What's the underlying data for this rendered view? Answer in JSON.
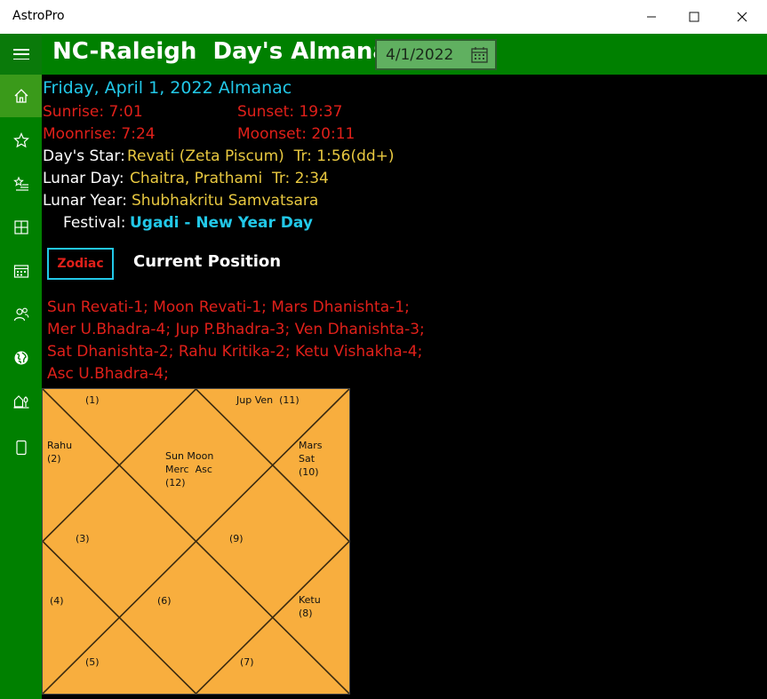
{
  "window": {
    "title": "AstroPro",
    "min_label": "—",
    "max_label": "☐",
    "close_label": "✕"
  },
  "header": {
    "title": "NC-Raleigh  Day's Almanac",
    "date": "4/1/2022"
  },
  "sidebar": {
    "items": [
      {
        "icon": "home-icon",
        "active": true
      },
      {
        "icon": "star-icon"
      },
      {
        "icon": "starred-list-icon"
      },
      {
        "icon": "grid-icon"
      },
      {
        "icon": "calendar-icon"
      },
      {
        "icon": "people-icon"
      },
      {
        "icon": "globe-icon"
      },
      {
        "icon": "home-garden-icon"
      },
      {
        "icon": "page-icon"
      }
    ]
  },
  "almanac": {
    "heading": "Friday, April 1, 2022 Almanac",
    "sunrise": "Sunrise: 7:01",
    "sunset": "Sunset: 19:37",
    "moonrise": "Moonrise: 7:24",
    "moonset": "Moonset: 20:11",
    "days_star_label": "Day's Star:",
    "days_star_value": "Revati (Zeta Piscum)  Tr: 1:56(dd+)",
    "lunar_day_label": "Lunar Day:",
    "lunar_day_value": "Chaitra, Prathami  Tr: 2:34",
    "lunar_year_label": "Lunar Year:",
    "lunar_year_value": "Shubhakritu Samvatsara",
    "festival_label": "Festival:",
    "festival_value": "Ugadi - New Year Day"
  },
  "zodiac_button": "Zodiac",
  "current_position_label": "Current Position",
  "positions_text": "Sun Revati-1; Moon Revati-1; Mars Dhanishta-1; Mer U.Bhadra-4; Jup P.Bhadra-3; Ven Dhanishta-3; Sat Dhanishta-2; Rahu Kritika-2; Ketu Vishakha-4; Asc U.Bhadra-4;",
  "chart": {
    "houses": {
      "h1": "(1)",
      "h11": "Jup Ven  (11)",
      "h2": "Rahu\n(2)",
      "h12": "Sun Moon\nMerc  Asc\n(12)",
      "h10": "Mars\nSat\n(10)",
      "h3": "(3)",
      "h9": "(9)",
      "h4": "(4)",
      "h6": "(6)",
      "h8": "Ketu\n(8)",
      "h5": "(5)",
      "h7": "(7)"
    },
    "colors": {
      "fill": "#f8ae3e",
      "line": "#3a2a10"
    }
  },
  "colors": {
    "green": "#008000",
    "cyan": "#22c8e8",
    "red": "#e0201a",
    "gold": "#e8c840"
  }
}
